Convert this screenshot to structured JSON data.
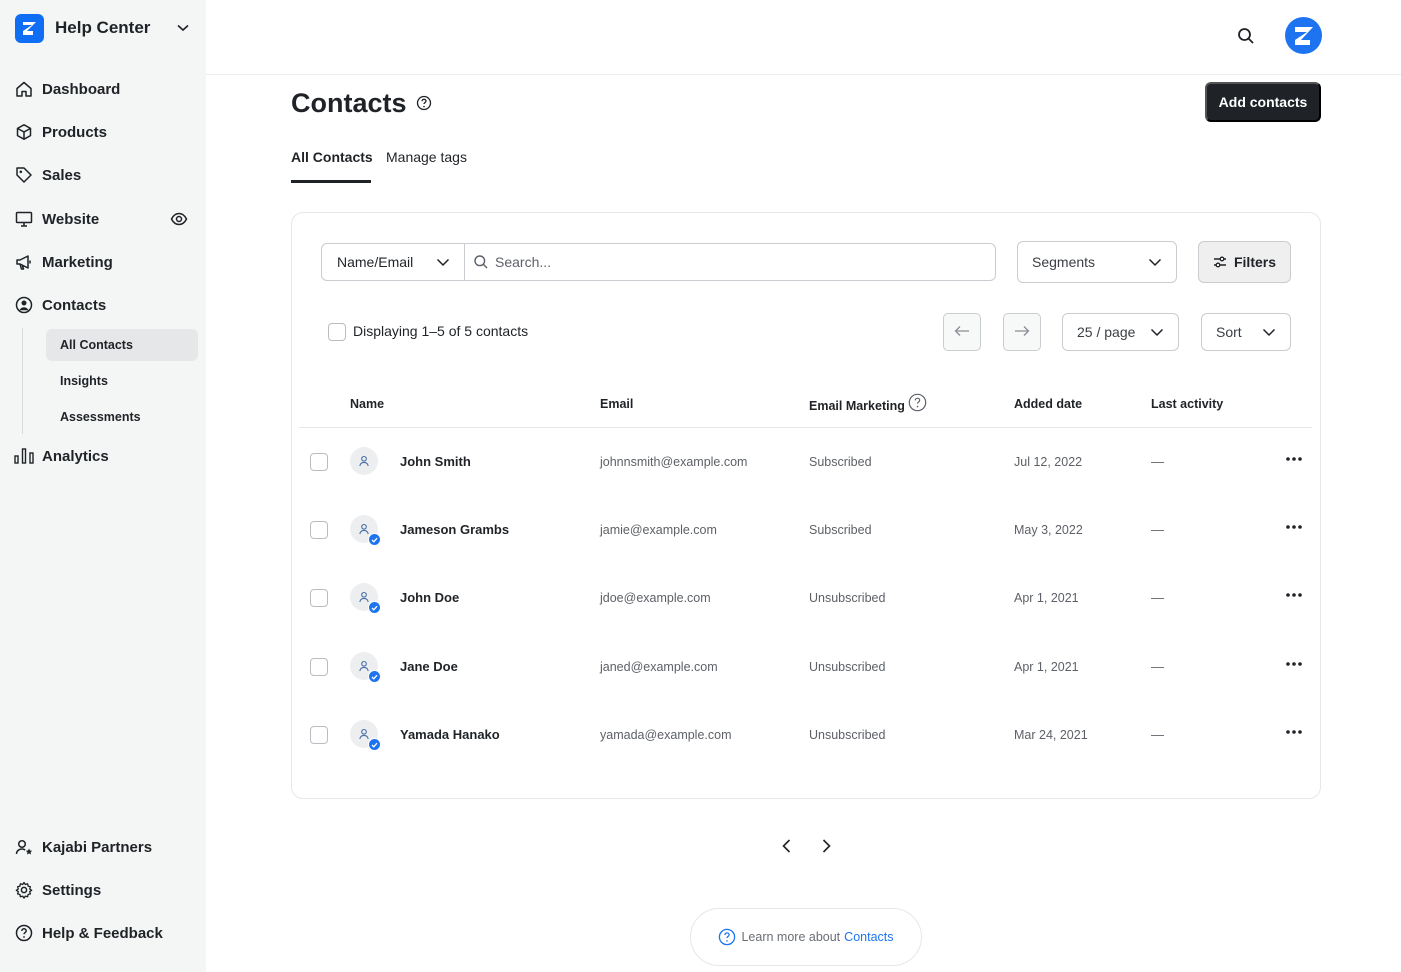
{
  "brand": {
    "name": "Help Center"
  },
  "sidebar": {
    "items": [
      {
        "label": "Dashboard",
        "icon": "home-icon"
      },
      {
        "label": "Products",
        "icon": "box-icon"
      },
      {
        "label": "Sales",
        "icon": "tag-icon"
      },
      {
        "label": "Website",
        "icon": "monitor-icon"
      },
      {
        "label": "Marketing",
        "icon": "megaphone-icon"
      },
      {
        "label": "Contacts",
        "icon": "user-circle-icon"
      },
      {
        "label": "Analytics",
        "icon": "bar-chart-icon"
      }
    ],
    "subitems": [
      {
        "label": "All Contacts",
        "active": true
      },
      {
        "label": "Insights",
        "active": false
      },
      {
        "label": "Assessments",
        "active": false
      }
    ],
    "bottom": [
      {
        "label": "Kajabi Partners",
        "icon": "partner-icon"
      },
      {
        "label": "Settings",
        "icon": "gear-icon"
      },
      {
        "label": "Help & Feedback",
        "icon": "help-circle-icon"
      }
    ]
  },
  "header": {
    "title": "Contacts",
    "add_button": "Add contacts",
    "tabs": [
      {
        "label": "All Contacts",
        "active": true
      },
      {
        "label": "Manage tags",
        "active": false
      }
    ]
  },
  "toolbar": {
    "field_select": "Name/Email",
    "search_placeholder": "Search...",
    "segments": "Segments",
    "filters": "Filters",
    "displaying": "Displaying 1–5 of 5 contacts",
    "per_page": "25 / page",
    "sort": "Sort"
  },
  "table": {
    "columns": [
      "Name",
      "Email",
      "Email Marketing",
      "Added date",
      "Last activity"
    ],
    "rows": [
      {
        "name": "John Smith",
        "email": "johnnsmith@example.com",
        "marketing": "Subscribed",
        "added": "Jul 12, 2022",
        "last": "—",
        "verified": false
      },
      {
        "name": "Jameson Grambs",
        "email": "jamie@example.com",
        "marketing": "Subscribed",
        "added": "May 3, 2022",
        "last": "—",
        "verified": true
      },
      {
        "name": "John Doe",
        "email": "jdoe@example.com",
        "marketing": "Unsubscribed",
        "added": "Apr 1, 2021",
        "last": "—",
        "verified": true
      },
      {
        "name": "Jane Doe",
        "email": "janed@example.com",
        "marketing": "Unsubscribed",
        "added": "Apr 1, 2021",
        "last": "—",
        "verified": true
      },
      {
        "name": "Yamada Hanako",
        "email": "yamada@example.com",
        "marketing": "Unsubscribed",
        "added": "Mar 24, 2021",
        "last": "—",
        "verified": true
      }
    ]
  },
  "footer": {
    "learn_text": "Learn more about",
    "learn_link": "Contacts"
  },
  "colors": {
    "accent": "#1e74f0",
    "dark": "#1f2327",
    "sidebar_bg": "#f4f5f5"
  }
}
